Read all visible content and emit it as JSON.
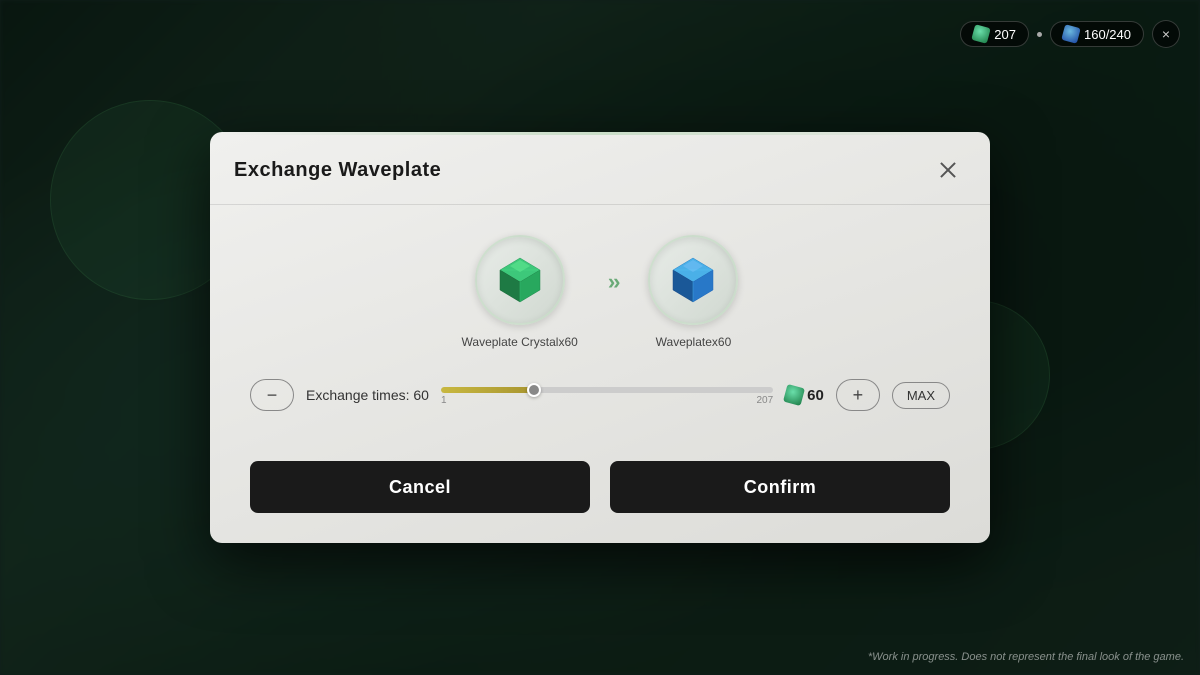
{
  "hud": {
    "crystal_value": "207",
    "wave_value": "160/240",
    "close_label": "×"
  },
  "modal": {
    "title": "Exchange Waveplate",
    "close_icon": "✕",
    "from_item": {
      "label": "Waveplate Crystalx60",
      "type": "crystal_green"
    },
    "to_item": {
      "label": "Waveplatex60",
      "type": "crystal_blue"
    },
    "arrow": "»",
    "exchange": {
      "label": "Exchange times: 60",
      "min": "1",
      "max": "207",
      "current": "60",
      "progress_pct": "28",
      "cost_value": "60",
      "minus_label": "−",
      "plus_label": "+",
      "max_btn_label": "MAX"
    },
    "cancel_label": "Cancel",
    "confirm_label": "Confirm"
  },
  "disclaimer": "*Work in progress. Does not represent the final look of the game."
}
